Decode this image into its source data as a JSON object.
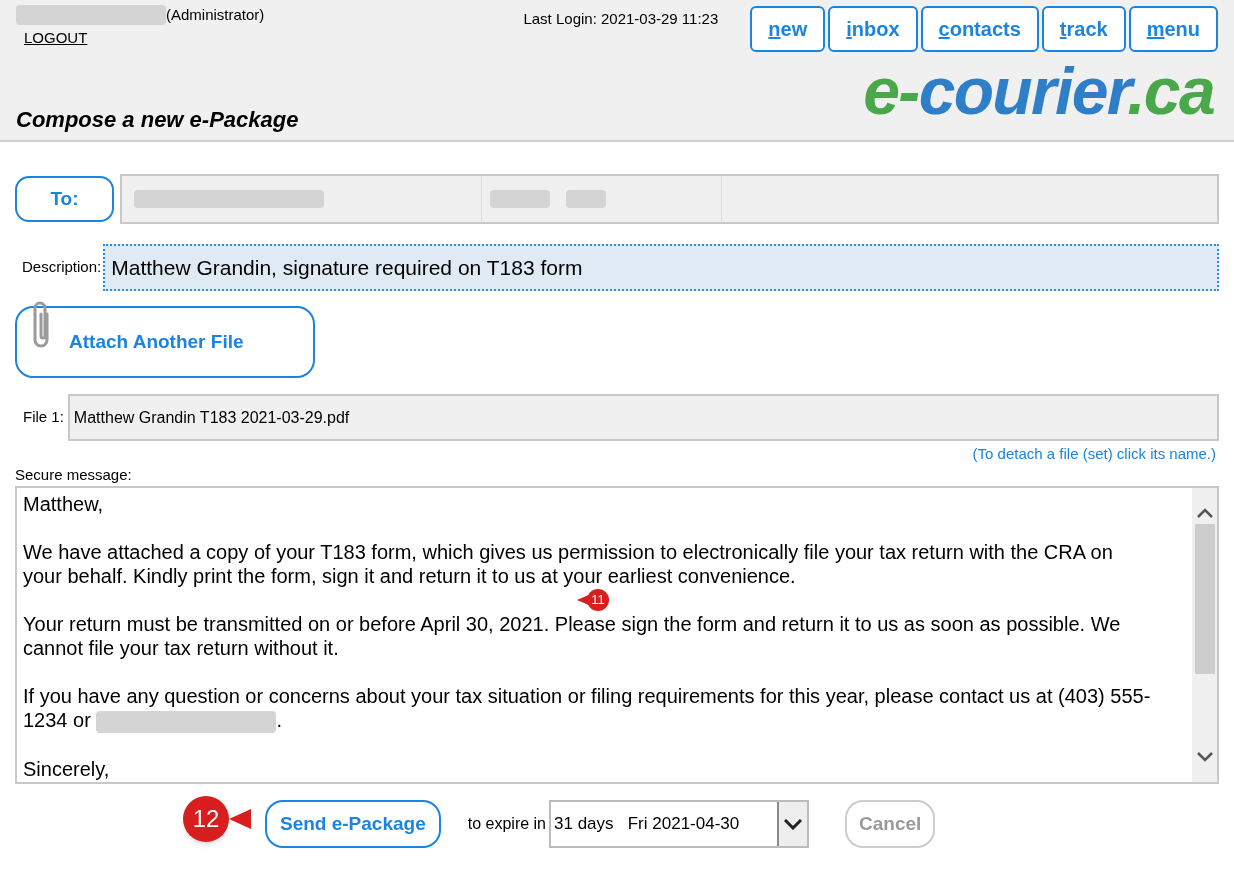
{
  "header": {
    "user_role": "(Administrator)",
    "logout": "LOGOUT",
    "last_login": "Last Login: 2021-03-29 11:23",
    "nav": [
      {
        "label": "new"
      },
      {
        "label": "inbox"
      },
      {
        "label": "contacts"
      },
      {
        "label": "track"
      },
      {
        "label": "menu"
      }
    ],
    "logo": [
      {
        "text": "e-",
        "color": "#4aa84a"
      },
      {
        "text": "courier",
        "color": "#2f7fc8"
      },
      {
        "text": ".ca",
        "color": "#4aa84a"
      }
    ],
    "page_title": "Compose a new e-Package"
  },
  "to": {
    "button": "To:"
  },
  "description": {
    "label": "Description:",
    "value": "Matthew Grandin, signature required on T183 form"
  },
  "attach_button": "Attach Another File",
  "files": [
    {
      "label": "File 1:",
      "name": "Matthew Grandin T183 2021-03-29.pdf"
    }
  ],
  "detach_hint": "(To detach a file (set) click its name.)",
  "message": {
    "label": "Secure message:",
    "paragraphs": [
      {
        "text": "Matthew,",
        "redacted_suffix": false
      },
      {
        "text": "We have attached a copy of your T183 form, which gives us permission to electronically file your tax return with the CRA on your behalf. Kindly print the form, sign it and return it to us at your earliest convenience.",
        "redacted_suffix": false
      },
      {
        "text": "Your return must be transmitted on or before April 30, 2021. Please sign the form and return it to us as soon as possible. We cannot file your tax return without it.",
        "redacted_suffix": false
      },
      {
        "text": "If you have any question or concerns about your tax situation or filing requirements for this year, please contact us at (403) 555-1234 or",
        "redacted_suffix": true,
        "end": "."
      },
      {
        "text": "Sincerely,",
        "redacted_suffix": false
      }
    ]
  },
  "footer": {
    "send": "Send e-Package",
    "expire_label": "to expire in",
    "expire_value": "31 days   Fri 2021-04-30",
    "cancel": {
      "label": "Cancel",
      "disabled": true
    }
  },
  "callouts": [
    "11",
    "12"
  ]
}
